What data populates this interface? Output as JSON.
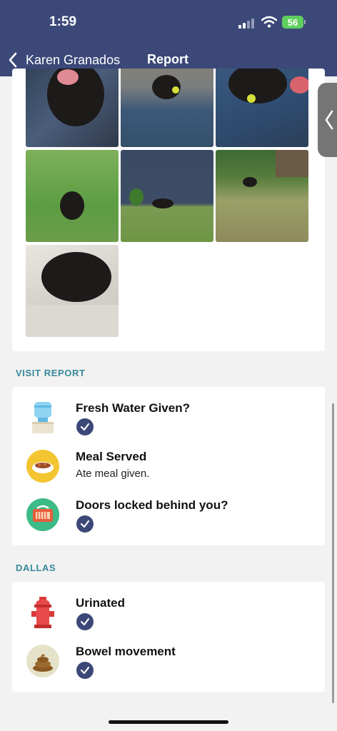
{
  "status_bar": {
    "time": "1:59",
    "battery": "56"
  },
  "nav": {
    "back_label": "Karen Granados",
    "title": "Report"
  },
  "photos": [
    "dog-photo-1",
    "dog-photo-2",
    "dog-photo-3",
    "dog-photo-4",
    "dog-photo-5",
    "dog-photo-6",
    "dog-photo-7"
  ],
  "visit_report": {
    "header": "VISIT REPORT",
    "items": [
      {
        "title": "Fresh Water Given?",
        "icon": "water-cooler-icon",
        "checked": true
      },
      {
        "title": "Meal Served",
        "subtitle": "Ate meal given.",
        "icon": "food-bowl-icon"
      },
      {
        "title": "Doors locked behind you?",
        "icon": "pet-carrier-icon",
        "checked": true
      }
    ]
  },
  "pet_section": {
    "header": "DALLAS",
    "items": [
      {
        "title": "Urinated",
        "icon": "fire-hydrant-icon",
        "checked": true
      },
      {
        "title": "Bowel movement",
        "icon": "poop-icon",
        "checked": true
      }
    ]
  },
  "colors": {
    "header_bg": "#3b4878",
    "accent_teal": "#37899a",
    "check_bg": "#3b4878"
  }
}
